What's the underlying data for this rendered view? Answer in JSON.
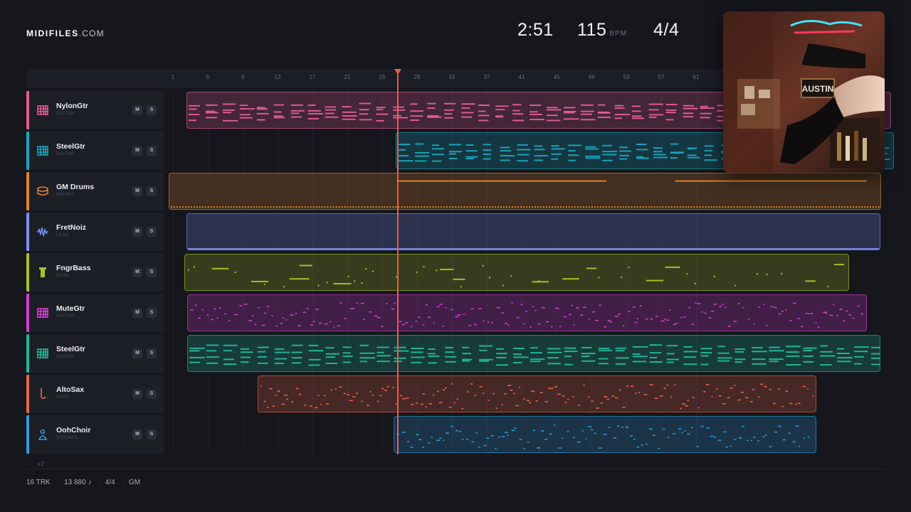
{
  "brand": {
    "name": "MIDIFILES",
    "suffix": ".COM"
  },
  "header": {
    "time": "2:51",
    "tempo": "115",
    "tempo_unit": "BPM",
    "meter": "4/4"
  },
  "ruler": {
    "bars": [
      "1",
      "5",
      "9",
      "13",
      "17",
      "21",
      "25",
      "29",
      "33",
      "37",
      "41",
      "45",
      "49",
      "53",
      "57",
      "61"
    ]
  },
  "playhead_bar": 25,
  "tracks": [
    {
      "name": "NylonGtr",
      "category": "GUITAR",
      "color": "#e15b97",
      "icon": "guitar-icon",
      "mute": "M",
      "solo": "S"
    },
    {
      "name": "SteelGtr",
      "category": "GUITAR",
      "color": "#15a6bf",
      "icon": "guitar-icon",
      "mute": "M",
      "solo": "S"
    },
    {
      "name": "GM Drums",
      "category": "DRUMS",
      "color": "#e0822a",
      "icon": "drum-icon",
      "mute": "M",
      "solo": "S"
    },
    {
      "name": "FretNoiz",
      "category": "LEAD",
      "color": "#7d8ff0",
      "icon": "waveform-icon",
      "mute": "M",
      "solo": "S"
    },
    {
      "name": "FngrBass",
      "category": "BASS",
      "color": "#a8c324",
      "icon": "bass-icon",
      "mute": "M",
      "solo": "S"
    },
    {
      "name": "MuteGtr",
      "category": "GUITAR",
      "color": "#d63ed6",
      "icon": "guitar-icon",
      "mute": "M",
      "solo": "S"
    },
    {
      "name": "SteelGtr",
      "category": "GUITAR",
      "color": "#1fb89a",
      "icon": "guitar-icon",
      "mute": "M",
      "solo": "S"
    },
    {
      "name": "AltoSax",
      "category": "REED",
      "color": "#ec6547",
      "icon": "saxophone-icon",
      "mute": "M",
      "solo": "S"
    },
    {
      "name": "OohChoir",
      "category": "STRINGS",
      "color": "#2f9bdc",
      "icon": "choir-icon",
      "mute": "M",
      "solo": "S"
    }
  ],
  "more_tracks": "+7",
  "footer": {
    "tracks": "16 TRK",
    "notes": "13 880 ♪",
    "meter": "4/4",
    "standard": "GM"
  },
  "album_art": {
    "sign_text": "AUSTIN"
  }
}
